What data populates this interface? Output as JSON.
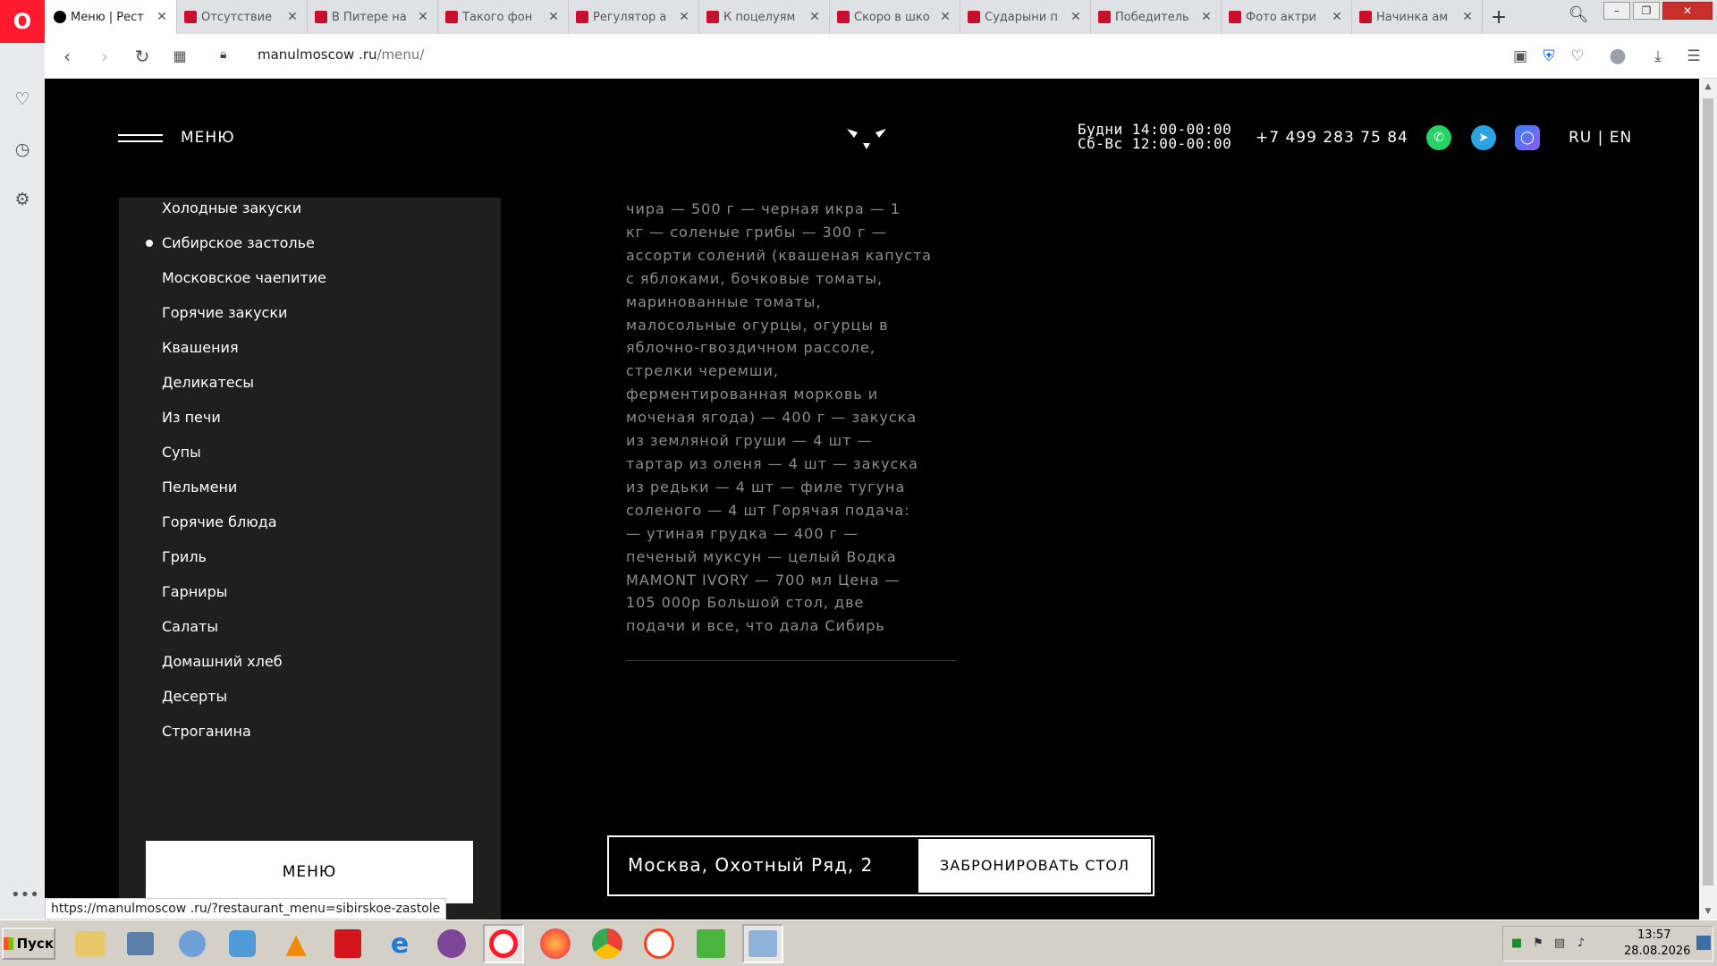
{
  "browser": {
    "tabs": [
      {
        "label": "Меню | Рест",
        "active": true
      },
      {
        "label": "Отсутствие"
      },
      {
        "label": "В Питере на"
      },
      {
        "label": "Такого фон"
      },
      {
        "label": "Регулятор а"
      },
      {
        "label": "К поцелуям"
      },
      {
        "label": "Скоро в шко"
      },
      {
        "label": "Сударыни п"
      },
      {
        "label": "Победитель"
      },
      {
        "label": "Фото актри"
      },
      {
        "label": "Начинка ам"
      }
    ],
    "url_host": "manulmoscow .ru",
    "url_path": "/menu/",
    "status_url": "https://manulmoscow .ru/?restaurant_menu=sibirskoe-zastole"
  },
  "header": {
    "menu_label": "МЕНЮ",
    "hours_weekdays": "Будни 14:00-00:00",
    "hours_weekend": "Сб-Вс 12:00-00:00",
    "phone": "+7 499 283 75 84",
    "lang": "RU | EN"
  },
  "categories": [
    {
      "label": "Холодные закуски"
    },
    {
      "label": "Сибирское застолье",
      "active": true
    },
    {
      "label": "Московское чаепитие"
    },
    {
      "label": "Горячие закуски"
    },
    {
      "label": "Квашения"
    },
    {
      "label": "Деликатесы"
    },
    {
      "label": "Из печи"
    },
    {
      "label": "Супы"
    },
    {
      "label": "Пельмени"
    },
    {
      "label": "Горячие блюда"
    },
    {
      "label": "Гриль"
    },
    {
      "label": "Гарниры"
    },
    {
      "label": "Салаты"
    },
    {
      "label": "Домашний хлеб"
    },
    {
      "label": "Десерты"
    },
    {
      "label": "Строганина"
    }
  ],
  "category_menu_button": "МЕНЮ",
  "dish": {
    "description_lines": [
      "чира — 500 г — черная икра — 1",
      "кг — соленые грибы — 300 г —",
      "ассорти солений (квашеная капуста",
      "с яблоками, бочковые томаты,",
      "маринованные томаты,",
      "малосольные огурцы, огурцы в",
      "яблочно-гвоздичном рассоле,",
      "стрелки черемши,",
      "ферментированная морковь и",
      "моченая ягода) — 400 г — закуска",
      "из земляной груши — 4 шт —",
      "тартар из оленя — 4 шт — закуска",
      "из редьки — 4 шт — филе тугуна",
      "соленого — 4 шт Горячая подача:",
      "— утиная грудка — 400 г —",
      "печеный муксун — целый Водка",
      "MAMONT IVORY — 700 мл Цена —",
      "105 000р Большой стол, две",
      "подачи и все, что дала Сибирь"
    ]
  },
  "booking": {
    "address": "Москва, Охотный Ряд, 2",
    "button": "ЗАБРОНИРОВАТЬ СТОЛ"
  },
  "taskbar": {
    "start_label": "Пуск",
    "time": "13:57",
    "date": "28.08.2026"
  },
  "colors": {
    "opera_red": "#ff1b2d",
    "whatsapp": "#25d366",
    "telegram": "#2aa3e0",
    "page_bg": "#000000",
    "panel_bg": "#1f1f1f"
  }
}
